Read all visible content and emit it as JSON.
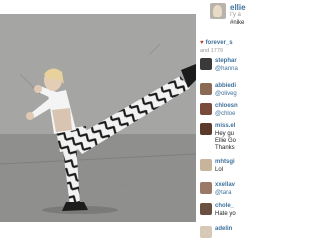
{
  "post": {
    "username": "ellie",
    "subtitle": "I'y a",
    "caption": "#nike"
  },
  "likes": {
    "liker": "forever_s",
    "count_text": "and 1779"
  },
  "comments": [
    {
      "user": "stephar",
      "lines": [
        "@hanna"
      ],
      "mention": true,
      "avatar_color": "#3a3a3a"
    },
    {
      "user": "abbiedi",
      "lines": [
        "@oliveg"
      ],
      "mention": true,
      "avatar_color": "#8a6a52"
    },
    {
      "user": "chloesn",
      "lines": [
        "@chloe"
      ],
      "mention": true,
      "avatar_color": "#7a4a3a"
    },
    {
      "user": "miss.el",
      "lines": [
        "Hey gu",
        "Ellie Go",
        "Thanks"
      ],
      "mention": false,
      "avatar_color": "#5a3a2a"
    },
    {
      "user": "mhtsgi",
      "lines": [
        "Lol"
      ],
      "mention": false,
      "avatar_color": "#c8b49a"
    },
    {
      "user": "xxellav",
      "lines": [
        "@tara"
      ],
      "mention": true,
      "avatar_color": "#9a7a66"
    },
    {
      "user": "chole_",
      "lines": [
        "Hate yo"
      ],
      "mention": false,
      "avatar_color": "#6a5040"
    },
    {
      "user": "adelin",
      "lines": [],
      "mention": false,
      "avatar_color": "#d8c8b8"
    }
  ]
}
